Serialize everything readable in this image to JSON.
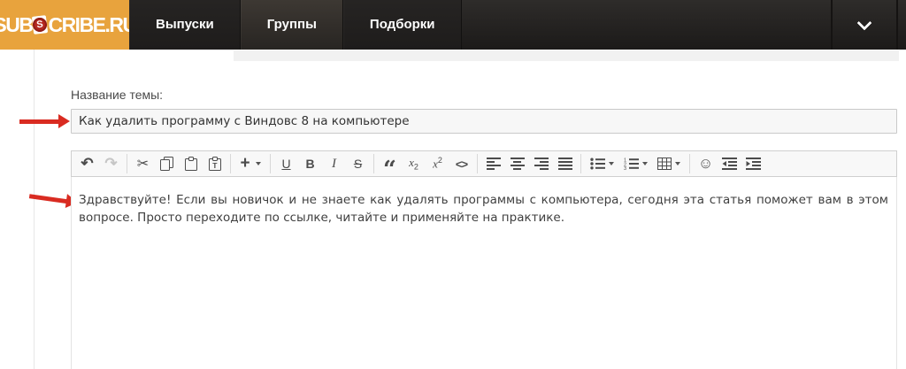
{
  "colors": {
    "brand_orange": "#e8a33d",
    "badge_red": "#b5271f",
    "arrow_red": "#d92b21",
    "nav_dark": "#1c1a19"
  },
  "header": {
    "logo": {
      "pre": "SUB",
      "badge_letter": "S",
      "post": "CRIBE.RU"
    },
    "tabs": [
      {
        "label": "Выпуски",
        "active": false
      },
      {
        "label": "Группы",
        "active": true
      },
      {
        "label": "Подборки",
        "active": false
      }
    ],
    "chevron_icon": "chevron-down-icon"
  },
  "form": {
    "topic_label": "Название темы:",
    "topic_value": "Как удалить программу с Виндовс 8 на компьютере"
  },
  "editor": {
    "toolbar": {
      "buttons": [
        "undo-icon",
        "redo-icon",
        "cut-icon",
        "copy-icon",
        "paste-icon",
        "paste-text-icon",
        "insert-plus-icon",
        "underline-icon",
        "bold-icon",
        "italic-icon",
        "strikethrough-icon",
        "blockquote-icon",
        "subscript-icon",
        "superscript-icon",
        "code-icon",
        "align-left-icon",
        "align-center-icon",
        "align-right-icon",
        "align-justify-icon",
        "bullet-list-icon",
        "numbered-list-icon",
        "table-icon",
        "emoticons-icon",
        "outdent-icon",
        "indent-icon"
      ],
      "glyphs": {
        "undo": "↶",
        "redo": "↷",
        "cut": "✂",
        "plus": "+",
        "underline": "U",
        "bold": "B",
        "italic": "I",
        "strike": "S",
        "quote": "“",
        "sub_base": "x",
        "sub_small": "2",
        "sup_base": "x",
        "sup_small": "2",
        "code": "<>",
        "smiley": "☺"
      }
    },
    "content": "Здравствуйте! Если вы новичок и не знаете как удалять программы с компьютера, сегодня эта статья поможет вам в этом вопросе. Просто переходите по ссылке, читайте и применяйте на практике."
  },
  "annotations": {
    "arrow_count": 2,
    "arrow_color": "#d92b21"
  }
}
